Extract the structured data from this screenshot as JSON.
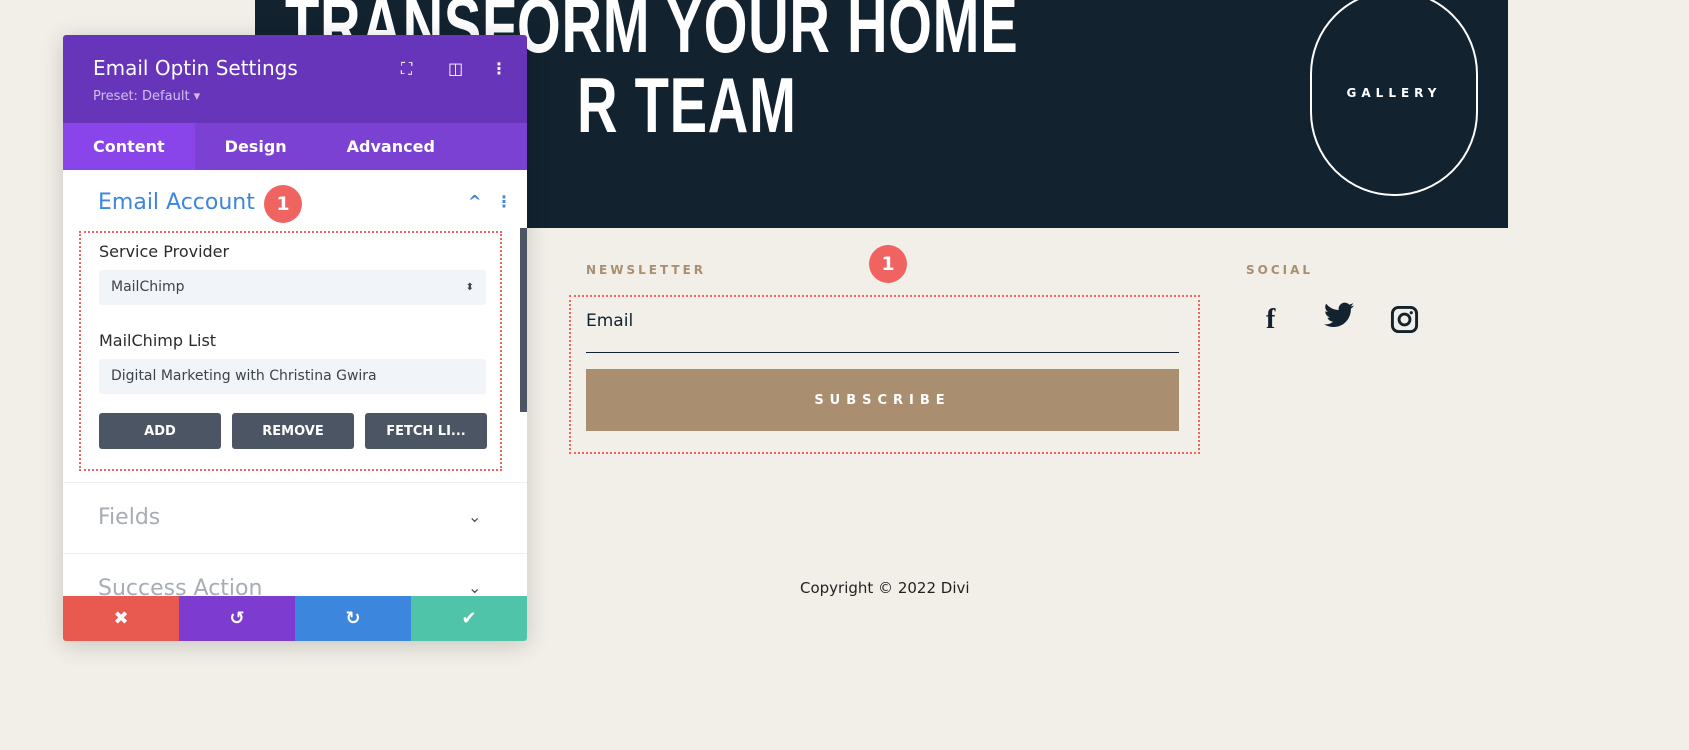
{
  "hero": {
    "line1": "TRANSFORM YOUR HOME",
    "line2": "R TEAM",
    "gallery": "GALLERY"
  },
  "footer": {
    "newsletter_label": "NEWSLETTER",
    "badge": "1",
    "email_placeholder": "Email",
    "subscribe": "SUBSCRIBE",
    "social_label": "SOCIAL",
    "social": [
      "facebook-icon",
      "twitter-icon",
      "instagram-icon"
    ],
    "copyright": "Copyright © 2022 Divi"
  },
  "panel": {
    "title": "Email Optin Settings",
    "preset": "Preset: Default ▾",
    "tabs": [
      "Content",
      "Design",
      "Advanced"
    ],
    "sections": {
      "email_account": "Email Account",
      "badge": "1",
      "fields": "Fields",
      "success_action": "Success Action"
    },
    "service_provider_label": "Service Provider",
    "service_provider_value": "MailChimp",
    "list_label": "MailChimp List",
    "list_value": "Digital Marketing with Christina Gwira",
    "buttons": [
      "ADD",
      "REMOVE",
      "FETCH LI..."
    ],
    "colors": {
      "header": "#6735b9",
      "tabs": "#7b41d3",
      "cancel": "#e85a4f",
      "undo": "#7d3bcf",
      "redo": "#3d86dd",
      "save": "#4fc4a8",
      "accent": "#3d86dd"
    }
  }
}
